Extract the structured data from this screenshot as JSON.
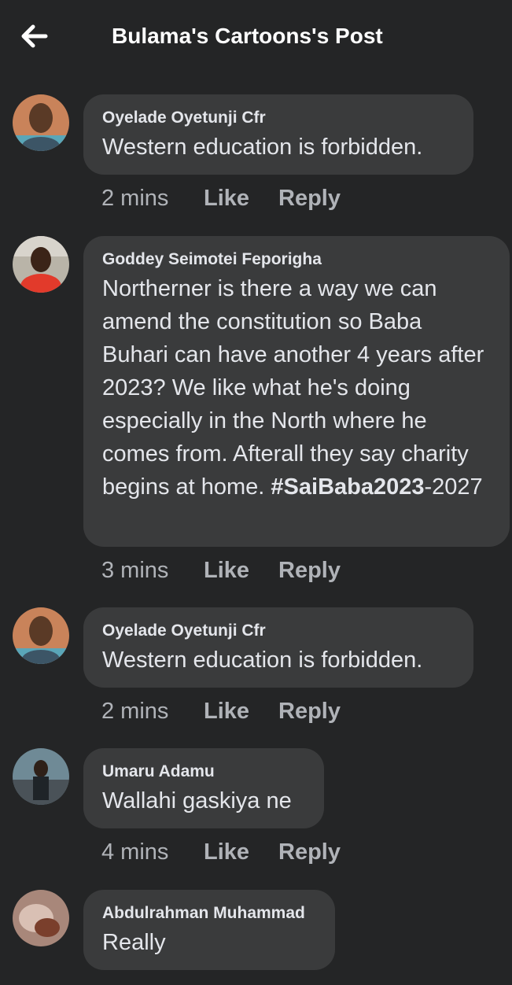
{
  "header": {
    "title": "Bulama's Cartoons's Post",
    "back_icon": "arrow-left-icon"
  },
  "comments": [
    {
      "author": "Oyelade Oyetunji Cfr",
      "text": "Western education is forbidden.",
      "time": "2 mins",
      "like_label": "Like",
      "reply_label": "Reply"
    },
    {
      "author": "Goddey Seimotei Feporigha",
      "text": "Northerner is there a way we can amend the constitution so Baba Buhari can have another 4 years after 2023? We like what he's doing especially in the North where he comes from. Afterall they say charity begins at home.",
      "hashtag": "#SaiBaba2023",
      "hashtag_suffix": "-2027",
      "time": "3 mins",
      "like_label": "Like",
      "reply_label": "Reply"
    },
    {
      "author": "Oyelade Oyetunji Cfr",
      "text": "Western education is forbidden.",
      "time": "2 mins",
      "like_label": "Like",
      "reply_label": "Reply"
    },
    {
      "author": "Umaru Adamu",
      "text": "Wallahi gaskiya ne",
      "time": "4 mins",
      "like_label": "Like",
      "reply_label": "Reply"
    },
    {
      "author": "Abdulrahman Muhammad",
      "text": "Really"
    }
  ],
  "colors": {
    "background": "#242526",
    "bubble": "#3a3b3c",
    "text": "#e4e6eb",
    "secondary_text": "#b0b3b8"
  }
}
